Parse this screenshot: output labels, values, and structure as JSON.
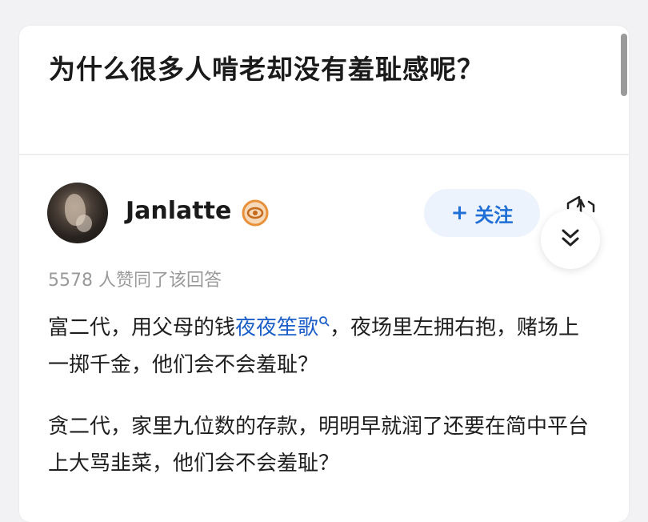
{
  "question": {
    "title": "为什么很多人啃老却没有羞耻感呢？"
  },
  "author": {
    "name": "Janlatte",
    "badge_icon": "eye-medal-icon"
  },
  "actions": {
    "follow_plus": "+",
    "follow_label": "关注",
    "share_icon": "share-icon",
    "scroll_icon": "chevron-double-down-icon"
  },
  "answer": {
    "votes_text": "5578 人赞同了该回答",
    "paragraphs": [
      {
        "before_link": "富二代，用父母的钱",
        "link": "夜夜笙歌",
        "link_icon": "search-mini-icon",
        "after_link": "，夜场里左拥右抱，赌场上一掷千金，他们会不会羞耻？"
      },
      {
        "text": "贪二代，家里九位数的存款，明明早就润了还要在简中平台上大骂韭菜，他们会不会羞耻？"
      }
    ]
  },
  "colors": {
    "accent": "#1f6fd6",
    "link": "#1d5fc8",
    "follow_bg": "#edf3fc",
    "muted": "#9a9a9a",
    "badge": "#e8913a"
  }
}
